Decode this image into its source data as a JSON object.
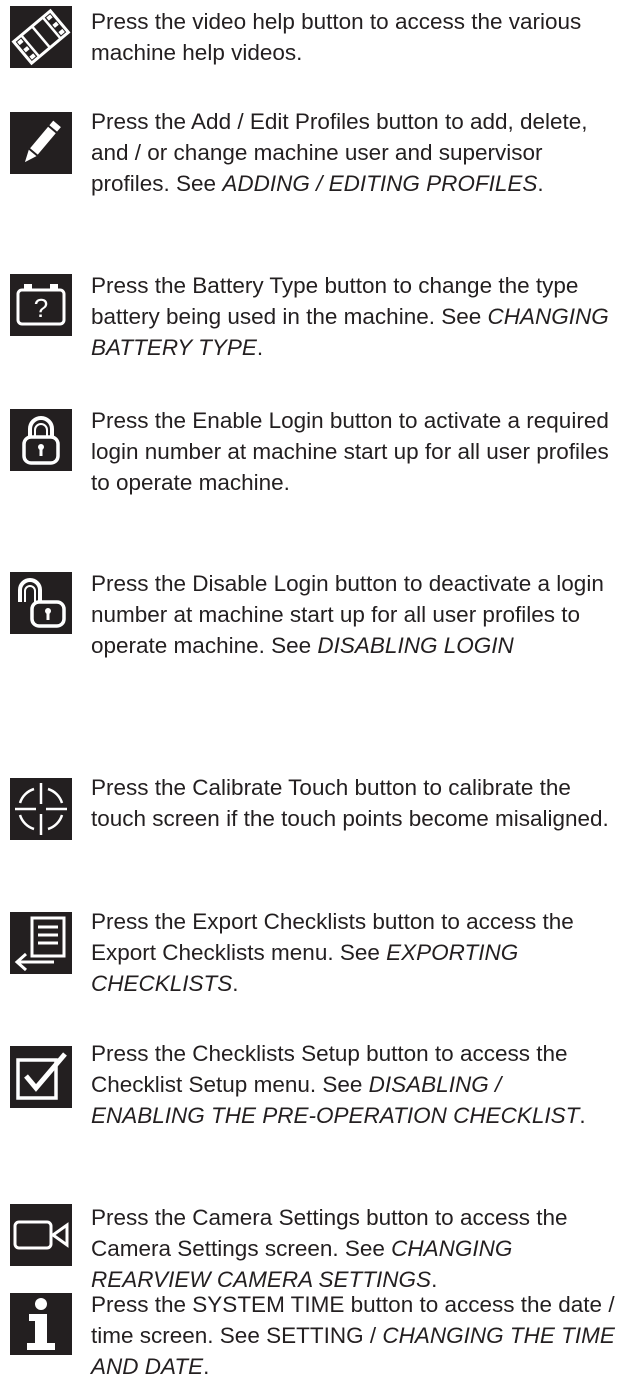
{
  "entries": [
    {
      "icon": "film-strip-icon",
      "text": "Press the video help button to access the various machine help videos.",
      "ref": "",
      "tail": ""
    },
    {
      "icon": "pencil-icon",
      "text": "Press the Add / Edit Profiles button to add, delete, and / or change machine user and supervisor profiles. See ",
      "ref": "ADDING / EDITING PROFILES",
      "tail": "."
    },
    {
      "icon": "battery-question-icon",
      "text": "Press the Battery Type button to change the type battery being used in the machine. See ",
      "ref": "CHANGING BATTERY TYPE",
      "tail": "."
    },
    {
      "icon": "lock-closed-icon",
      "text": "Press the Enable Login button to activate a required login number at machine start up for all user profiles to operate machine.",
      "ref": "",
      "tail": ""
    },
    {
      "icon": "lock-open-icon",
      "text": "Press the Disable Login button to deactivate a login number at machine start up for all user profiles to operate machine. See ",
      "ref": "DISABLING LOGIN",
      "tail": ""
    },
    {
      "icon": "crosshair-icon",
      "text": "Press the Calibrate Touch button to calibrate the touch screen if the touch points become misaligned.",
      "ref": "",
      "tail": ""
    },
    {
      "icon": "export-list-icon",
      "text": "Press the Export Checklists button to access the Export Checklists menu. See ",
      "ref": "EXPORTING CHECKLISTS",
      "tail": "."
    },
    {
      "icon": "checkbox-checked-icon",
      "text": "Press the Checklists Setup button to access the Checklist Setup menu. See ",
      "ref": "DISABLING / ENABLING THE PRE-OPERATION CHECKLIST",
      "tail": "."
    },
    {
      "icon": "camera-icon",
      "text": "Press the Camera Settings button to access the Camera Settings screen. See ",
      "ref": "CHANGING REARVIEW CAMERA SETTINGS",
      "tail": "."
    },
    {
      "icon": "info-icon",
      "text": "Press the SYSTEM TIME button to access the date / time screen. See SETTING / ",
      "ref": "CHANGING THE TIME AND DATE",
      "tail": "."
    }
  ],
  "colors": {
    "text": "#231f20",
    "icon_background": "#231f20",
    "icon_foreground": "#ffffff"
  }
}
